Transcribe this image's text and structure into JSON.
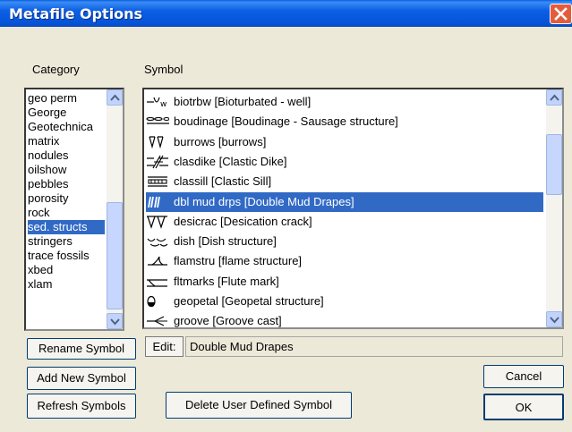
{
  "window": {
    "title": "Metafile Options"
  },
  "labels": {
    "category": "Category",
    "symbol": "Symbol"
  },
  "categories": {
    "items": [
      "geo perm",
      "George",
      "Geotechnica",
      "matrix",
      "nodules",
      "oilshow",
      "pebbles",
      "porosity",
      "rock",
      "sed. structs",
      "stringers",
      "trace fossils",
      "xbed",
      "xlam"
    ],
    "selected": "sed. structs"
  },
  "symbols": {
    "items": [
      {
        "text": "biotrbw [Bioturbated - well]",
        "icon": "bioturbation-icon"
      },
      {
        "text": "boudinage [Boudinage - Sausage structure]",
        "icon": "boudinage-icon"
      },
      {
        "text": "burrows [burrows]",
        "icon": "burrows-icon"
      },
      {
        "text": "clasdike [Clastic Dike]",
        "icon": "clastic-dike-icon"
      },
      {
        "text": "classill [Clastic Sill]",
        "icon": "clastic-sill-icon"
      },
      {
        "text": "dbl mud drps [Double Mud Drapes]",
        "icon": "double-mud-drapes-icon"
      },
      {
        "text": "desicrac [Desication crack]",
        "icon": "desiccation-crack-icon"
      },
      {
        "text": "dish [Dish structure]",
        "icon": "dish-structure-icon"
      },
      {
        "text": "flamstru [flame structure]",
        "icon": "flame-structure-icon"
      },
      {
        "text": "fltmarks [Flute mark]",
        "icon": "flute-mark-icon"
      },
      {
        "text": "geopetal [Geopetal structure]",
        "icon": "geopetal-icon"
      },
      {
        "text": "groove [Groove cast]",
        "icon": "groove-cast-icon"
      }
    ],
    "selected": "dbl mud drps [Double Mud Drapes]"
  },
  "edit": {
    "label": "Edit:",
    "value": "Double Mud Drapes"
  },
  "buttons": {
    "rename": "Rename Symbol",
    "add": "Add New Symbol",
    "refresh": "Refresh Symbols",
    "delete": "Delete User Defined Symbol",
    "cancel": "Cancel",
    "ok": "OK"
  }
}
